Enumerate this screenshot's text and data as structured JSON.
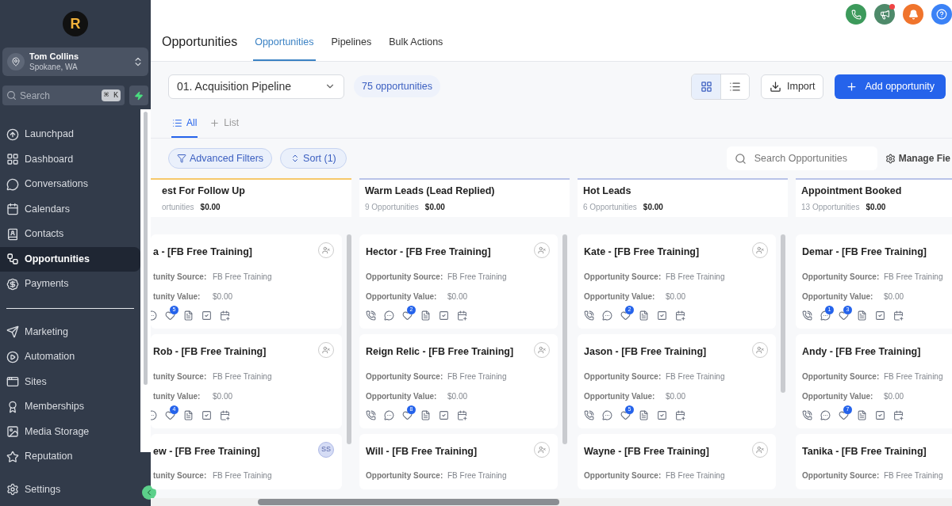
{
  "sidebar": {
    "logo": "R",
    "user": {
      "name": "Tom Collins",
      "location": "Spokane, WA"
    },
    "search": {
      "placeholder": "Search",
      "shortcut": "⌘ K"
    },
    "nav_groups": [
      [
        {
          "label": "Launchpad",
          "selected": false
        },
        {
          "label": "Dashboard",
          "selected": false
        },
        {
          "label": "Conversations",
          "selected": false
        },
        {
          "label": "Calendars",
          "selected": false
        },
        {
          "label": "Contacts",
          "selected": false
        },
        {
          "label": "Opportunities",
          "selected": true
        },
        {
          "label": "Payments",
          "selected": false
        }
      ],
      [
        {
          "label": "Marketing",
          "selected": false
        },
        {
          "label": "Automation",
          "selected": false
        },
        {
          "label": "Sites",
          "selected": false
        },
        {
          "label": "Memberships",
          "selected": false
        },
        {
          "label": "Media Storage",
          "selected": false
        },
        {
          "label": "Reputation",
          "selected": false
        }
      ]
    ],
    "settings": "Settings"
  },
  "header": {
    "title": "Opportunities",
    "tabs": [
      {
        "label": "Opportunities",
        "selected": true
      },
      {
        "label": "Pipelines",
        "selected": false
      },
      {
        "label": "Bulk Actions",
        "selected": false
      }
    ]
  },
  "toolbar": {
    "pipeline": "01. Acquisition Pipeline",
    "count": "75 opportunities",
    "view_buttons": [
      {
        "selected": true
      },
      {
        "selected": false
      }
    ],
    "import": "Import",
    "add": "Add opportunity"
  },
  "view_tabs": [
    {
      "label": "All",
      "selected": true
    },
    {
      "label": "List",
      "selected": false
    }
  ],
  "filters": {
    "advanced": "Advanced Filters",
    "sort": "Sort (1)",
    "search_placeholder": "Search Opportunities",
    "manage": "Manage Fie"
  },
  "columns": [
    {
      "title": "est For Follow Up",
      "count": "ortunities",
      "value": "$0.00",
      "color": "#f6c86a",
      "cards": [
        {
          "title": "a - [FB Free Training]",
          "fields": [
            {
              "label": "tunity Source:",
              "value": "FB Free Training"
            },
            {
              "label": "tunity Value:",
              "value": "$0.00"
            }
          ],
          "actions": true,
          "tag_count": "5"
        },
        {
          "title": "Rob - [FB Free Training]",
          "fields": [
            {
              "label": "tunity Source:",
              "value": "FB Free Training"
            },
            {
              "label": "tunity Value:",
              "value": "$0.00"
            }
          ],
          "actions": true,
          "tag_count": "4"
        },
        {
          "title": "ew - [FB Free Training]",
          "avatar": "SS",
          "fields": [
            {
              "label": "tunity Source:",
              "value": "FB Free Training"
            }
          ],
          "actions": false
        }
      ]
    },
    {
      "title": "Warm Leads (Lead Replied)",
      "count": "9 Opportunities",
      "value": "$0.00",
      "color": "#b9c3e8",
      "cards": [
        {
          "title": "Hector - [FB Free Training]",
          "fields": [
            {
              "label": "Opportunity Source:",
              "value": "FB Free Training"
            },
            {
              "label": "Opportunity Value:",
              "value": "$0.00"
            }
          ],
          "actions": true,
          "tag_count": "2"
        },
        {
          "title": "Reign Relic - [FB Free Training]",
          "fields": [
            {
              "label": "Opportunity Source:",
              "value": "FB Free Training"
            },
            {
              "label": "Opportunity Value:",
              "value": "$0.00"
            }
          ],
          "actions": true,
          "tag_count": "8"
        },
        {
          "title": "Will - [FB Free Training]",
          "fields": [
            {
              "label": "Opportunity Source:",
              "value": "FB Free Training"
            }
          ],
          "actions": false
        }
      ]
    },
    {
      "title": "Hot Leads",
      "count": "6 Opportunities",
      "value": "$0.00",
      "color": "#b9c3e8",
      "cards": [
        {
          "title": "Kate - [FB Free Training]",
          "fields": [
            {
              "label": "Opportunity Source:",
              "value": "FB Free Training"
            },
            {
              "label": "Opportunity Value:",
              "value": "$0.00"
            }
          ],
          "actions": true,
          "tag_count": "2"
        },
        {
          "title": "Jason - [FB Free Training]",
          "fields": [
            {
              "label": "Opportunity Source:",
              "value": "FB Free Training"
            },
            {
              "label": "Opportunity Value:",
              "value": "$0.00"
            }
          ],
          "actions": true,
          "tag_count": "5"
        },
        {
          "title": "Wayne - [FB Free Training]",
          "fields": [
            {
              "label": "Opportunity Source:",
              "value": "FB Free Training"
            }
          ],
          "actions": false
        }
      ]
    },
    {
      "title": "Appointment Booked",
      "count": "13 Opportunities",
      "value": "$0.00",
      "color": "#b9c3e8",
      "cards": [
        {
          "title": "Demar - [FB Free Training]",
          "fields": [
            {
              "label": "Opportunity Source:",
              "value": "FB Free Training"
            },
            {
              "label": "Opportunity Value:",
              "value": "$0.00"
            }
          ],
          "actions": true,
          "message_count": "1",
          "tag_count": "3"
        },
        {
          "title": "Andy - [FB Free Training]",
          "fields": [
            {
              "label": "Opportunity Source:",
              "value": "FB Free Training"
            },
            {
              "label": "Opportunity Value:",
              "value": "$0.00"
            }
          ],
          "actions": true,
          "tag_count": "7"
        },
        {
          "title": "Tanika - [FB Free Training]",
          "fields": [
            {
              "label": "Opportunity Source:",
              "value": "FB Free Training"
            }
          ],
          "actions": false
        }
      ]
    }
  ]
}
